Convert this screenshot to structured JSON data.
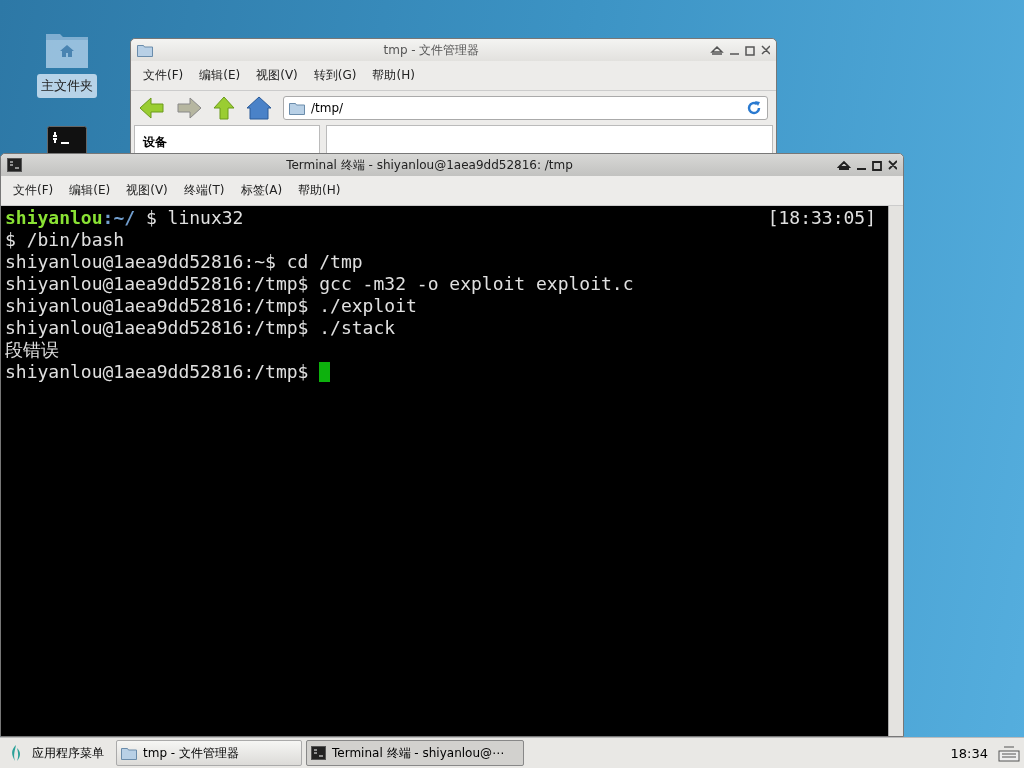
{
  "desktop": {
    "icons": [
      {
        "kind": "home",
        "label": "主文件夹",
        "selected": true
      },
      {
        "kind": "terminal"
      }
    ]
  },
  "file_manager": {
    "title": "tmp - 文件管理器",
    "menu": [
      "文件(F)",
      "编辑(E)",
      "视图(V)",
      "转到(G)",
      "帮助(H)"
    ],
    "location": "/tmp/",
    "sidebar_heading": "设备"
  },
  "terminal": {
    "title": "Terminal 终端 - shiyanlou@1aea9dd52816: /tmp",
    "menu": [
      "文件(F)",
      "编辑(E)",
      "视图(V)",
      "终端(T)",
      "标签(A)",
      "帮助(H)"
    ],
    "lines": [
      {
        "segments": [
          {
            "kind": "user",
            "text": "shiyanlou"
          },
          {
            "kind": "path",
            "text": ":~/"
          },
          {
            "kind": "plain",
            "text": " $ linux32"
          }
        ],
        "right": "[18:33:05]"
      },
      {
        "segments": [
          {
            "kind": "plain",
            "text": "$ /bin/bash"
          }
        ]
      },
      {
        "segments": [
          {
            "kind": "plain",
            "text": "shiyanlou@1aea9dd52816:~$ cd /tmp"
          }
        ]
      },
      {
        "segments": [
          {
            "kind": "plain",
            "text": "shiyanlou@1aea9dd52816:/tmp$ gcc -m32 -o exploit exploit.c"
          }
        ]
      },
      {
        "segments": [
          {
            "kind": "plain",
            "text": "shiyanlou@1aea9dd52816:/tmp$ ./exploit"
          }
        ]
      },
      {
        "segments": [
          {
            "kind": "plain",
            "text": "shiyanlou@1aea9dd52816:/tmp$ ./stack"
          }
        ]
      },
      {
        "segments": [
          {
            "kind": "plain",
            "text": "段错误"
          }
        ]
      },
      {
        "segments": [
          {
            "kind": "plain",
            "text": "shiyanlou@1aea9dd52816:/tmp$ "
          }
        ],
        "cursor": true
      }
    ]
  },
  "taskbar": {
    "app_menu": "应用程序菜单",
    "tasks": [
      {
        "kind": "files",
        "label": "tmp - 文件管理器",
        "selected": false
      },
      {
        "kind": "terminal",
        "label": "Terminal 终端 - shiyanlou@⋯",
        "selected": true
      }
    ],
    "clock": "18:34"
  }
}
